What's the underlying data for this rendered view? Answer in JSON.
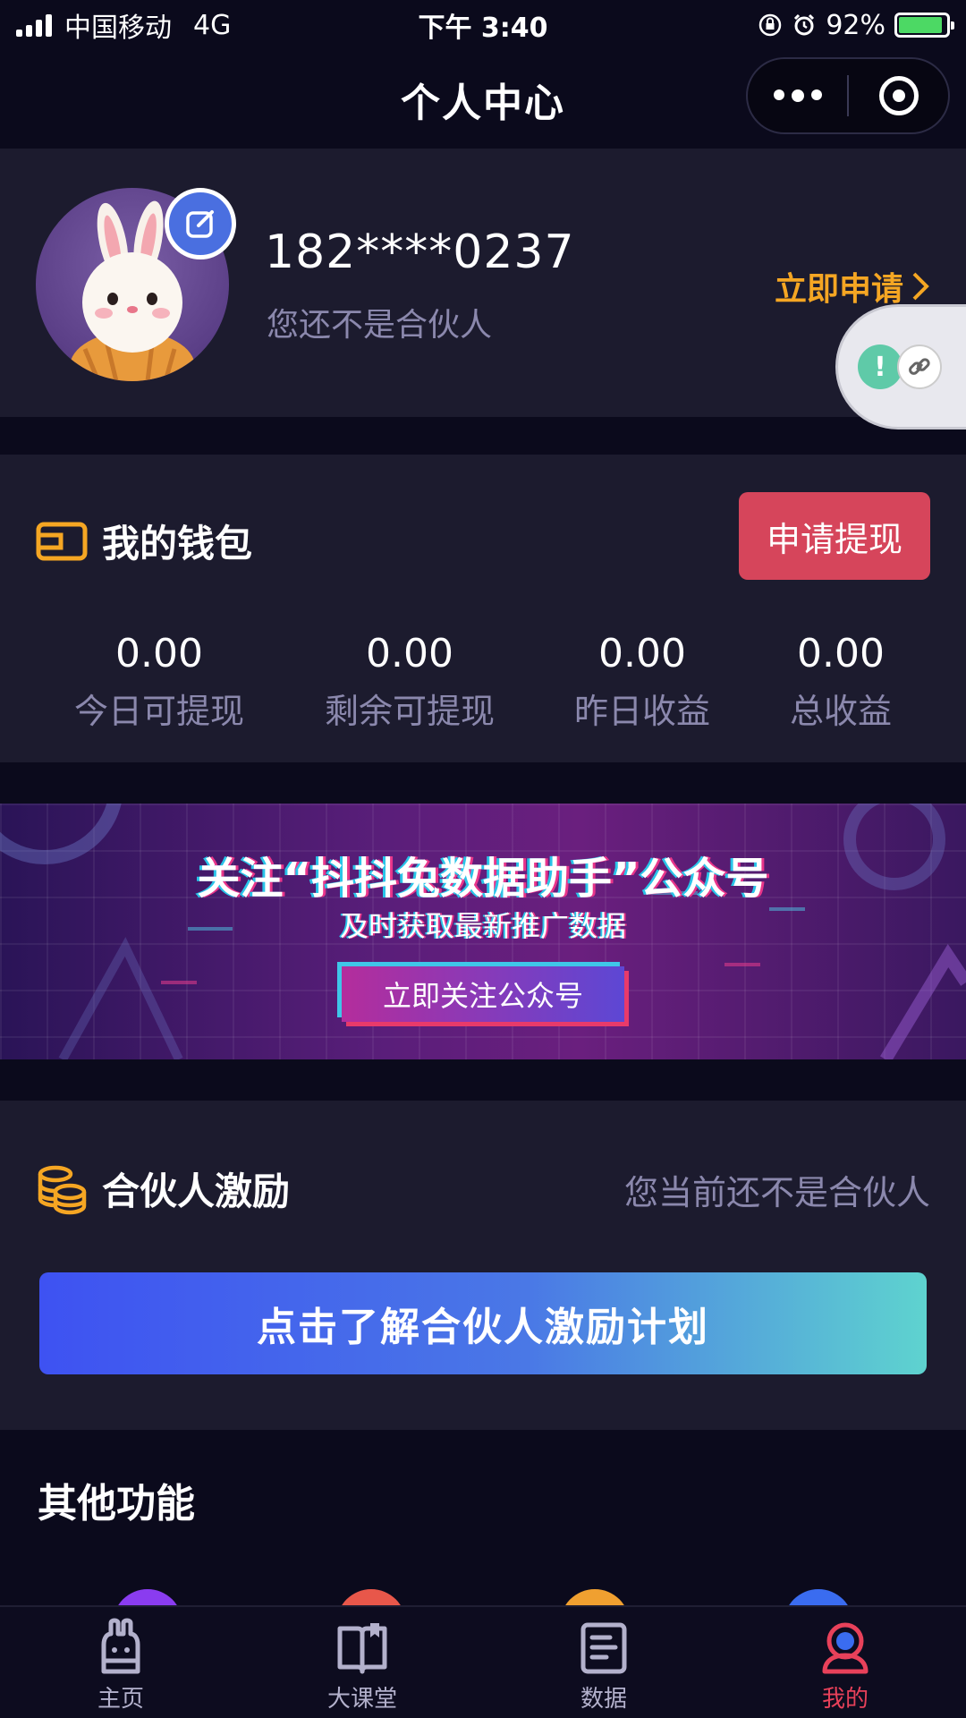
{
  "status_bar": {
    "carrier": "中国移动",
    "network": "4G",
    "time": "下午 3:40",
    "battery": "92%",
    "battery_level": 0.92
  },
  "nav": {
    "title": "个人中心",
    "more_icon": "more-dots-icon",
    "close_icon": "target-icon"
  },
  "profile": {
    "phone": "182****0237",
    "status": "您还不是合伙人",
    "apply_label": "立即申请",
    "avatar_icon": "rabbit-avatar",
    "edit_icon": "edit-icon"
  },
  "wallet": {
    "title": "我的钱包",
    "withdraw_label": "申请提现",
    "stats": [
      {
        "value": "0.00",
        "label": "今日可提现"
      },
      {
        "value": "0.00",
        "label": "剩余可提现"
      },
      {
        "value": "0.00",
        "label": "昨日收益"
      },
      {
        "value": "0.00",
        "label": "总收益"
      }
    ]
  },
  "banner": {
    "title": "关注“抖抖兔数据助手”公众号",
    "subtitle": "及时获取最新推广数据",
    "button_label": "立即关注公众号"
  },
  "partner": {
    "title": "合伙人激励",
    "note": "您当前还不是合伙人",
    "button_label": "点击了解合伙人激励计划"
  },
  "other": {
    "title": "其他功能"
  },
  "tabs": [
    {
      "label": "主页",
      "icon": "rabbit-home-icon",
      "active": false
    },
    {
      "label": "大课堂",
      "icon": "book-icon",
      "active": false
    },
    {
      "label": "数据",
      "icon": "document-icon",
      "active": false
    },
    {
      "label": "我的",
      "icon": "profile-icon",
      "active": true
    }
  ],
  "colors": {
    "background": "#0b0a1c",
    "card": "#1c1b2e",
    "accent_orange": "#f5a623",
    "accent_red": "#d6455b",
    "active_tab": "#e8415a"
  }
}
